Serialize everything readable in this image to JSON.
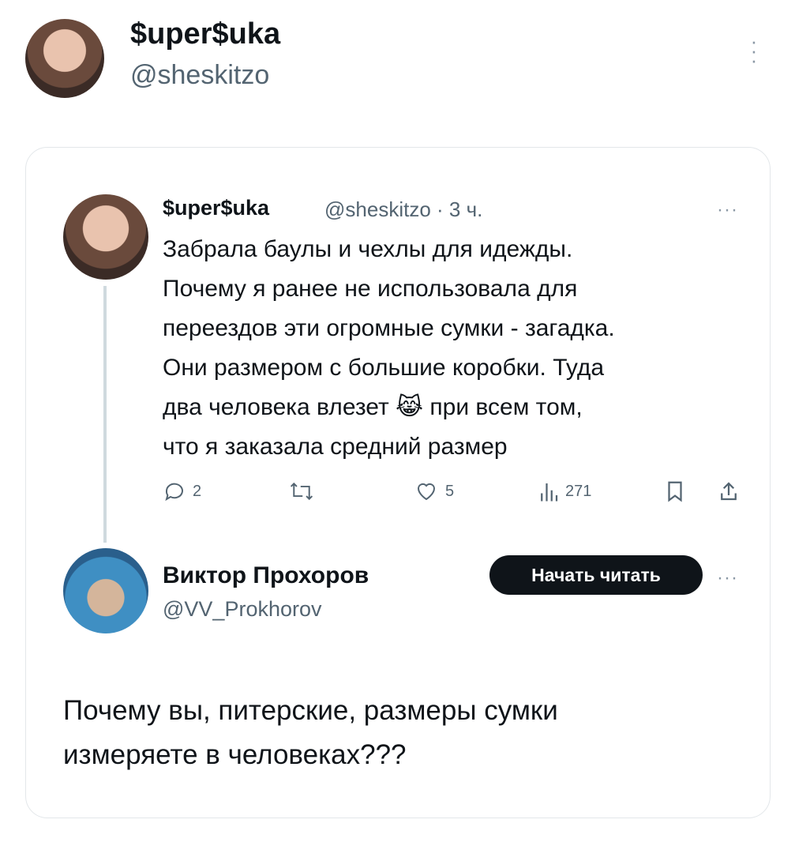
{
  "top_author": {
    "name": "$uper$uka",
    "handle": "@sheskitzo"
  },
  "quoted_tweet": {
    "name": "$uper$uka",
    "meta": "@sheskitzo · 3 ч.",
    "text": "Забрала баулы и чехлы для идежды.\nПочему я ранее не использовала для\nпереездов эти огромные сумки - загадка.\nОни размером с большие коробки. Туда\nдва человека влезет 😹 при всем том,\nчто я заказала средний размер",
    "actions": {
      "replies": "2",
      "likes": "5",
      "views": "271"
    }
  },
  "reply": {
    "name": "Виктор Прохоров",
    "handle": "@VV_Prokhorov",
    "follow_label": "Начать читать",
    "text": "Почему вы, питерские, размеры сумки\nизмеряете в человеках???"
  },
  "icons": [
    "avatar",
    "more-icon",
    "reply-icon",
    "retweet-icon",
    "like-icon",
    "views-icon",
    "bookmark-icon",
    "share-icon"
  ]
}
